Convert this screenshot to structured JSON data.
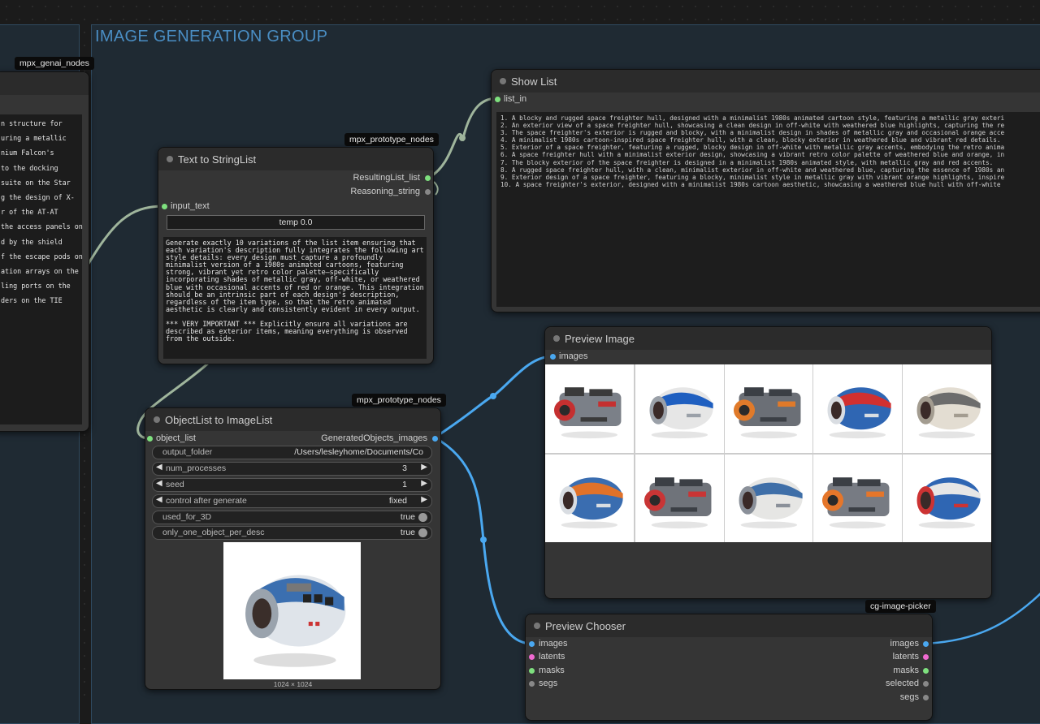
{
  "canvas": {
    "bg": "#1b1b1b",
    "link_color": "#4aa8f0",
    "string_link_color": "#9fb59c"
  },
  "group": {
    "title": "IMAGE GENERATION GROUP"
  },
  "left_node": {
    "badge": "mpx_genai_nodes",
    "lines": [
      "n structure for",
      "uring a metallic",
      "nium Falcon's",
      "to the docking",
      "suite on the Star",
      "g the design of X-",
      "r of the AT-AT",
      "the access panels on",
      "d by the shield",
      "f the escape pods on",
      "ation arrays on the",
      "ling ports on the",
      "ders on the TIE"
    ]
  },
  "text_to_stringlist": {
    "badge": "mpx_prototype_nodes",
    "title": "Text to StringList",
    "out1": "ResultingList_list",
    "out2": "Reasoning_string",
    "in1": "input_text",
    "temp_label": "temp",
    "temp_value": "0.0",
    "prompt": "Generate exactly 10 variations of the list item ensuring that each variation's description fully integrates the following art style details: every design must capture a profoundly minimalist version of a 1980s animated cartoons, featuring strong, vibrant yet retro color palette—specifically incorporating shades of metallic gray, off-white, or weathered blue with occasional accents of red or orange. This integration should be an intrinsic part of each design's description, regardless of the item type, so that the retro animated aesthetic is clearly and consistently evident in every output.\n\n*** VERY IMPORTANT *** Explicitly ensure all variations are described as exterior items, meaning everything is observed from the outside."
  },
  "show_list": {
    "title": "Show List",
    "in1": "list_in",
    "items": [
      "1. A blocky and rugged space freighter hull, designed with a minimalist 1980s animated cartoon style, featuring a metallic gray exteri",
      "2. An exterior view of a space freighter hull, showcasing a clean design in off-white with weathered blue highlights, capturing the re",
      "3. The space freighter's exterior is rugged and blocky, with a minimalist design in shades of metallic gray and occasional orange acce",
      "4. A minimalist 1980s cartoon-inspired space freighter hull, with a clean, blocky exterior in weathered blue and vibrant red details.",
      "5. Exterior of a space freighter, featuring a rugged, blocky design in off-white with metallic gray accents, embodying the retro anima",
      "6. A space freighter hull with a minimalist exterior design, showcasing a vibrant retro color palette of weathered blue and orange, in",
      "7. The blocky exterior of the space freighter is designed in a minimalist 1980s animated style, with metallic gray and red accents.",
      "8. A rugged space freighter hull, with a clean, minimalist exterior in off-white and weathered blue, capturing the essence of 1980s an",
      "9. Exterior design of a space freighter, featuring a blocky, minimalist style in metallic gray with vibrant orange highlights, inspire",
      "10. A space freighter's exterior, designed with a minimalist 1980s cartoon aesthetic, showcasing a weathered blue hull with off-white"
    ]
  },
  "objectlist": {
    "badge": "mpx_prototype_nodes",
    "title": "ObjectList to ImageList",
    "in1": "object_list",
    "out1": "GeneratedObjects_images",
    "widgets": [
      {
        "label": "output_folder",
        "value": "/Users/lesleyhome/Documents/Co",
        "kind": "text"
      },
      {
        "label": "num_processes",
        "value": "3",
        "kind": "number"
      },
      {
        "label": "seed",
        "value": "1",
        "kind": "number"
      },
      {
        "label": "control after generate",
        "value": "fixed",
        "kind": "combo"
      },
      {
        "label": "used_for_3D",
        "value": "true",
        "kind": "toggle"
      },
      {
        "label": "only_one_object_per_desc",
        "value": "true",
        "kind": "toggle"
      }
    ],
    "image_size": "1024 × 1024"
  },
  "preview_image": {
    "title": "Preview Image",
    "in1": "images",
    "thumbnails": [
      "gray-red-freighter",
      "white-blue-window-pod",
      "gray-orange-blocky-ship",
      "blue-red-pod",
      "white-gray-pod",
      "blue-orange-pod",
      "gray-red-blocky-ship",
      "white-blue-pod",
      "gray-orange-engine-ship",
      "blue-white-pod"
    ]
  },
  "preview_chooser": {
    "badge": "cg-image-picker",
    "title": "Preview Chooser",
    "inputs": [
      "images",
      "latents",
      "masks",
      "segs"
    ],
    "outputs": [
      "images",
      "latents",
      "masks",
      "selected",
      "segs"
    ]
  }
}
